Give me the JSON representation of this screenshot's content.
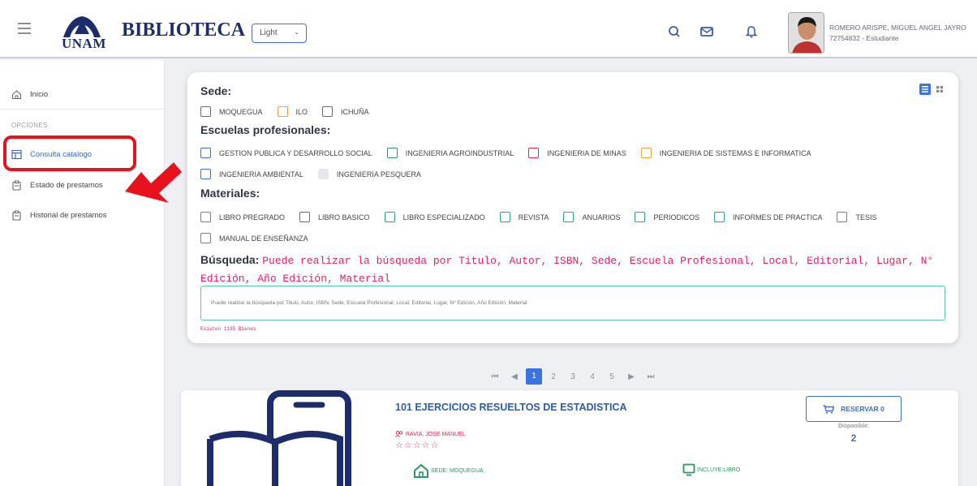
{
  "header": {
    "logo_text": "UNAM",
    "brand": "BIBLIOTECA",
    "theme_select": "Light",
    "user_name": "ROMERO ARISPE, MIGUEL ANGEL JAYRO",
    "user_sub": "72754832 - Estudiante"
  },
  "sidebar": {
    "home": "Inicio",
    "section": "OPCIONES",
    "items": [
      "Consulta catalogo",
      "Estado de prestamos",
      "Historial de prestamos"
    ]
  },
  "filters": {
    "sede_title": "Sede:",
    "sedes": [
      {
        "label": "MOQUEGUA",
        "color": "#3b6fd0"
      },
      {
        "label": "ILO",
        "color": "#e8a040"
      },
      {
        "label": "ICHUÑA",
        "color": "#3b6fd0"
      }
    ],
    "escuelas_title": "Escuelas profesionales:",
    "escuelas": [
      {
        "label": "GESTION PUBLICA Y DESARROLLO SOCIAL",
        "color": "#3b6fd0"
      },
      {
        "label": "INGENIERIA AGROINDUSTRIAL",
        "color": "#2a9960"
      },
      {
        "label": "INGENIERIA DE MINAS",
        "color": "#d42e4e"
      },
      {
        "label": "INGENIERIA DE SISTEMAS E INFORMATICA",
        "color": "#e8a040"
      },
      {
        "label": "INGENIERIA AMBIENTAL",
        "color": "#3b6fd0"
      },
      {
        "label": "INGENIERIA PESQUERA",
        "color": "#e6e8ec"
      }
    ],
    "materiales_title": "Materiales:",
    "materiales": [
      {
        "label": "LIBRO PREGRADO",
        "color": "#2aa0a0"
      },
      {
        "label": "LIBRO BASICO",
        "color": "#3b6fd0"
      },
      {
        "label": "LIBRO ESPECIALIZADO",
        "color": "#2aa0a0"
      },
      {
        "label": "REVISTA",
        "color": "#2aa0a0"
      },
      {
        "label": "ANUARIOS",
        "color": "#2aa0a0"
      },
      {
        "label": "PERIODICOS",
        "color": "#2aa0a0"
      },
      {
        "label": "INFORMES DE PRACTICA",
        "color": "#2aa0a0"
      },
      {
        "label": "TESIS",
        "color": "#2aa0a0"
      },
      {
        "label": "MANUAL DE ENSEÑANZA",
        "color": "#2aa0a0"
      }
    ],
    "search_title": "Búsqueda:",
    "search_hint": "Puede realizar la búsqueda por Titulo, Autor, ISBN, Sede, Escuela Profesional, Local, Editorial, Lugar, N° Edición, Año Edición, Material",
    "search_placeholder": "Puede realizar la búsqueda por Titulo, Autor, ISBN, Sede, Escuela Profesional, Local, Editorial, Lugar, N° Edición, Año Edición, Material",
    "count_text": "Existen 1195 Bienes"
  },
  "pagination": {
    "first": "⏮",
    "prev": "◀",
    "pages": [
      "1",
      "2",
      "3",
      "4",
      "5"
    ],
    "next": "▶",
    "last": "⏭",
    "current": "1"
  },
  "book": {
    "title": "101 EJERCICIOS RESUELTOS DE ESTADISTICA",
    "author": "RAVIA, JOSE MANUEL",
    "stars": "☆☆☆☆☆",
    "sede": "SEDE: MOQUEGUA",
    "incluye": "INCLUYE:LIBRO",
    "reserve": "RESERVAR 0",
    "disp_label": "Disponible:",
    "disp_value": "2"
  }
}
